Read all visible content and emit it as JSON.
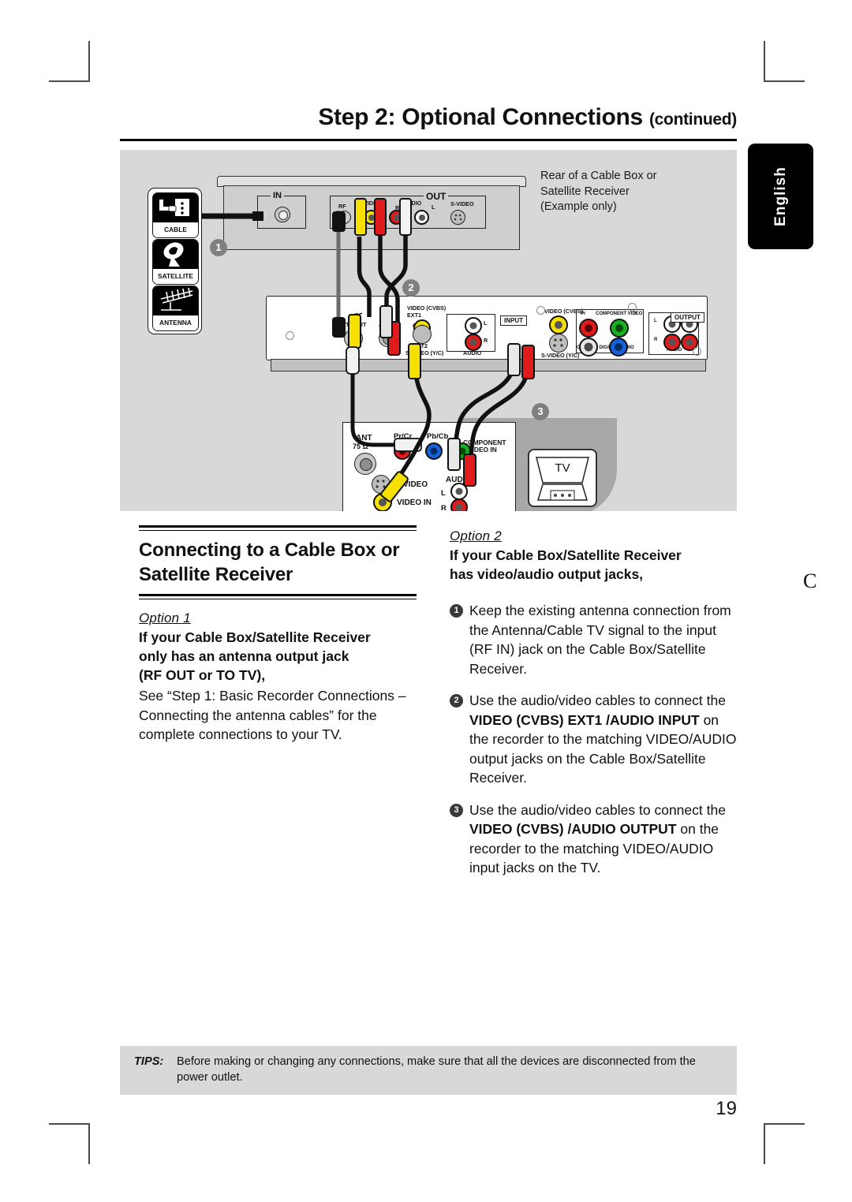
{
  "header": {
    "title": "Step 2: Optional Connections",
    "title_continued": "(continued)"
  },
  "language_tab": {
    "label": "English"
  },
  "diagram": {
    "caption": {
      "line1": "Rear of a Cable Box or",
      "line2": "Satellite Receiver",
      "line3": "(Example only)"
    },
    "source_legend": [
      {
        "label": "CABLE",
        "icon": "cable-wallplate-icon"
      },
      {
        "label": "SATELLITE",
        "icon": "satellite-dish-icon"
      },
      {
        "label": "ANTENNA",
        "icon": "yagi-antenna-icon"
      }
    ],
    "step_markers": [
      "1",
      "2",
      "3"
    ],
    "cable_box": {
      "in_group_label": "IN",
      "out_group_label": "OUT",
      "jacks": [
        {
          "label": "RF",
          "type": "coax"
        },
        {
          "label": "VIDEO",
          "color": "#f5e000"
        },
        {
          "label": "R",
          "color": "#e01b1b"
        },
        {
          "label": "AUDIO",
          "color": ""
        },
        {
          "label": "L",
          "color": "#ffffff"
        },
        {
          "label": "S-VIDEO",
          "type": "svideo"
        }
      ]
    },
    "recorder": {
      "input_group_label": "INPUT",
      "output_group_label": "OUTPUT",
      "left_labels": [
        "TV-OUT",
        "ANT-IN",
        "VIDEO (CVBS)",
        "EXT1",
        "EXT2",
        "S-VIDEO (Y/C)",
        "AUDIO",
        "L",
        "R"
      ],
      "right_labels": [
        "VIDEO (CVBS)",
        "S-VIDEO (Y/C)",
        "COMPONENT VIDEO",
        "Pr",
        "Y",
        "Pb",
        "COAXIAL DIGITAL AUDIO",
        "AUDIO",
        "L",
        "R"
      ]
    },
    "tv_panel": {
      "labels": [
        "ANT",
        "75 Ω",
        "Pr/Cr",
        "Pb/Cb",
        "COMPONENT",
        "VIDEO IN",
        "S-VIDEO",
        "VIDEO IN",
        "AUDIO",
        "L",
        "R"
      ]
    },
    "tv_set": {
      "label": "TV"
    }
  },
  "left_column": {
    "section_title_line1": "Connecting to a Cable Box or",
    "section_title_line2": "Satellite Receiver",
    "option_label": "Option 1",
    "lead_line1": "If your Cable Box/Satellite Receiver",
    "lead_line2": "only has an antenna output jack",
    "lead_line3": "(RF OUT or TO TV),",
    "body": "See “Step 1: Basic Recorder Connections – Connecting the antenna cables” for the complete connections to your TV."
  },
  "right_column": {
    "option_label": "Option 2",
    "lead_line1": "If your Cable Box/Satellite Receiver",
    "lead_line2": "has video/audio output jacks,",
    "steps": [
      {
        "number": "1",
        "text": "Keep the existing antenna connection from the Antenna/Cable TV signal to the input (RF IN) jack on the Cable Box/Satellite Receiver."
      },
      {
        "number": "2",
        "pre": "Use the audio/video cables to connect the ",
        "bold1": "VIDEO (CVBS) EXT1 /AUDIO INPUT",
        "post": " on the recorder to the matching VIDEO/AUDIO output jacks on the Cable Box/Satellite Receiver."
      },
      {
        "number": "3",
        "pre": "Use the audio/video cables to connect the ",
        "bold1": "VIDEO (CVBS) /AUDIO OUTPUT",
        "post": " on the recorder to the matching VIDEO/AUDIO input jacks on the TV."
      }
    ]
  },
  "edge_glyph": "C",
  "footer": {
    "tips_label": "TIPS:",
    "tips_text": "Before making or changing any connections, make sure that all the devices are disconnected from the power outlet.",
    "page_number": "19"
  }
}
